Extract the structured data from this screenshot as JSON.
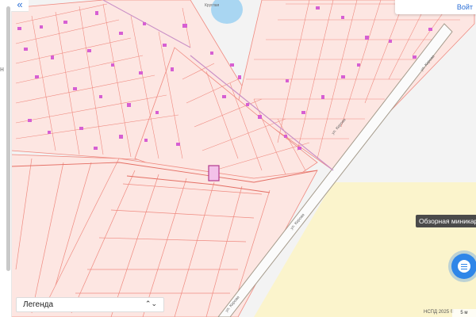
{
  "map": {
    "street_labels": {
      "kruglaya": "Круглая",
      "kirova_1": "ул. Кирова",
      "kirova_2": "ул. Кирова",
      "kirova_3": "ул. Кирова",
      "kirova_4": "ул. Кирова"
    },
    "colors": {
      "background": "#f3f3f3",
      "parcel_fill": "#fde6e2",
      "parcel_border": "#ef8a80",
      "building_fill": "#d65fd3",
      "pond_fill": "#a9d6f2",
      "yellow_zone": "#fbf4cc",
      "selected_parcel_fill": "#f3c1e9",
      "selected_parcel_border": "#b23a8e",
      "road_border": "#a59b8c"
    }
  },
  "controls": {
    "collapse_button": "«",
    "top_right_link": "Войт",
    "minimap_tooltip": "Обзорная миникарта",
    "rail_mark": "н"
  },
  "legend": {
    "label": "Легенда",
    "chevron": "⌃⌄"
  },
  "footer": {
    "copyright": "НСПД 2025 ©",
    "scale": "5 м"
  }
}
